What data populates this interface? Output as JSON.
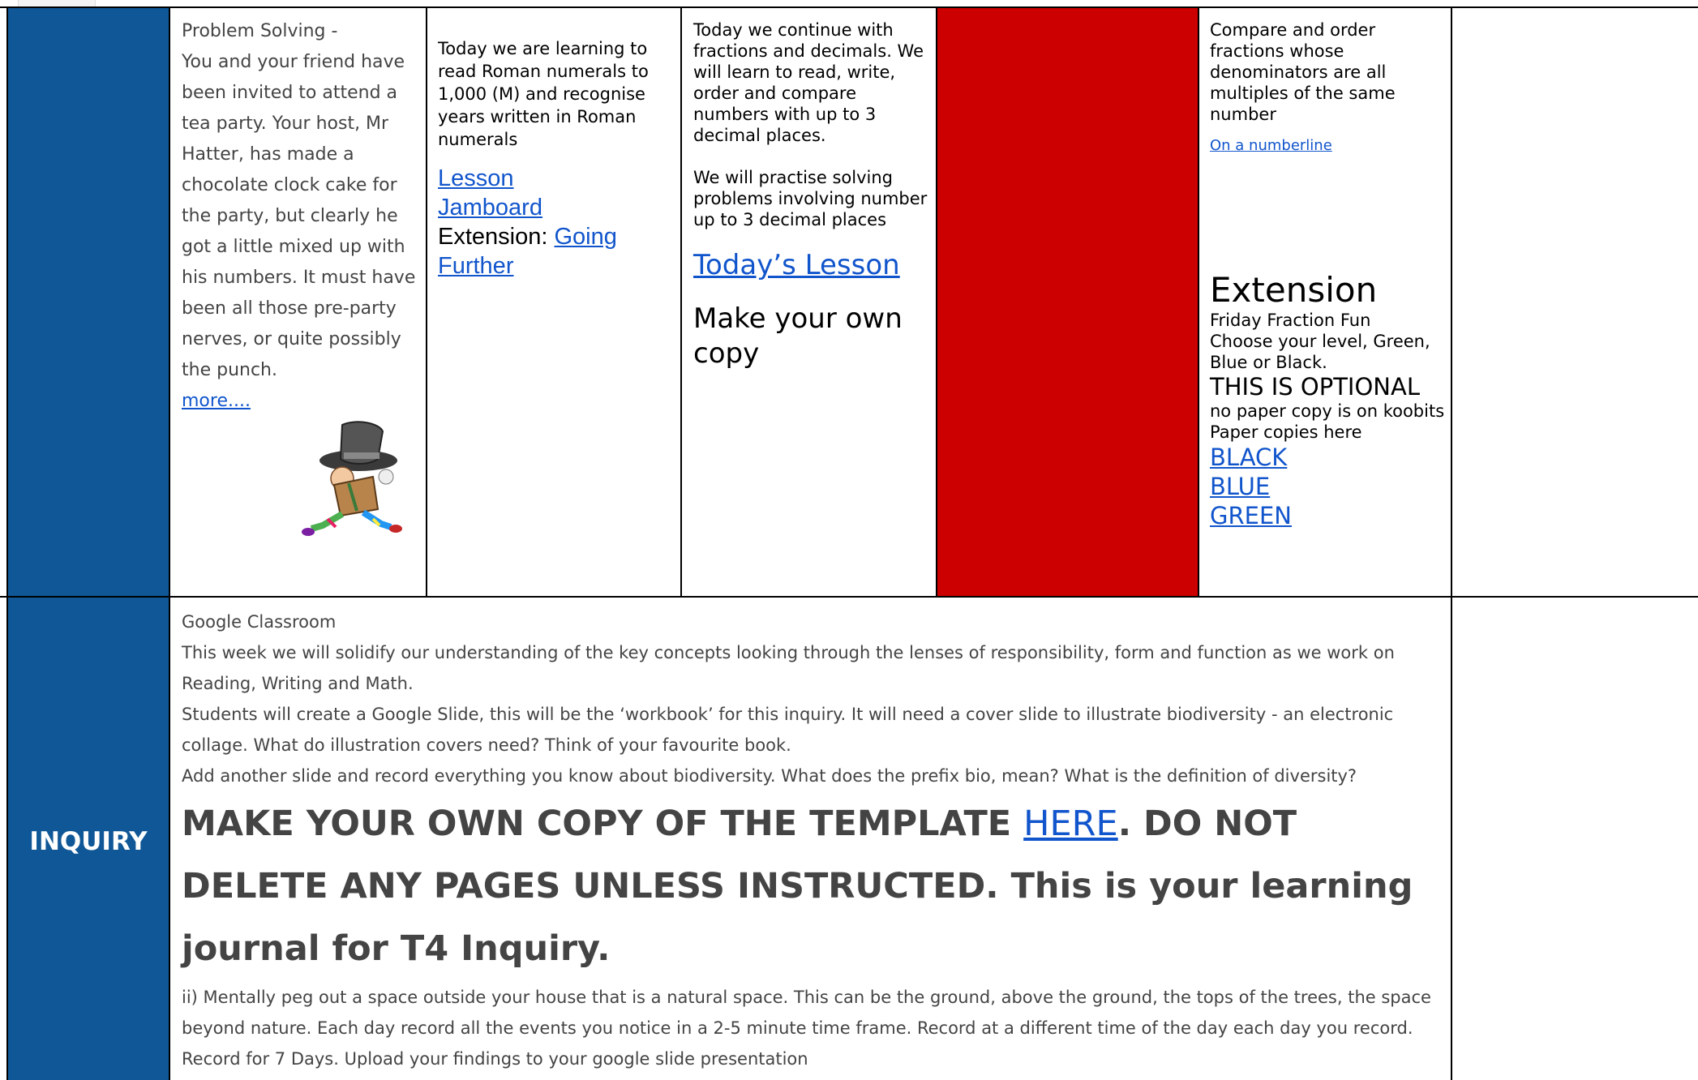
{
  "math_row": {
    "cell1": {
      "title": "Problem Solving -",
      "body": "You and your friend have been invited to attend a tea party. Your host, Mr Hatter, has made a chocolate clock cake for the party, but clearly he got a little mixed up with his numbers. It must have been all those pre-party nerves, or quite possibly the punch.",
      "more_link": "more...."
    },
    "cell2": {
      "intro": "Today we are learning to read Roman numerals to 1,000 (M) and recognise years written in Roman numerals",
      "lesson_link": "Lesson",
      "jamboard_link": "Jamboard",
      "extension_label": "Extension: ",
      "going_further_link": "Going Further"
    },
    "cell3": {
      "intro": "Today we continue with fractions and decimals. We will learn to read, write, order and compare numbers with up to 3 decimal places.",
      "practice": "We will practise solving problems involving number up to 3 decimal places",
      "todays_lesson_link": "Today’s Lesson",
      "make_copy": "Make your own copy"
    },
    "cell4": {
      "color": "#cc0000"
    },
    "cell5": {
      "intro": "Compare and order fractions whose denominators are all multiples of the same number",
      "numberline_link": "On a numberline",
      "extension_heading": "Extension",
      "fun_line1": "Friday Fraction Fun",
      "fun_line2": "Choose your level, Green, Blue or Black.",
      "optional": "THIS IS OPTIONAL",
      "no_paper": "no paper copy is on koobits",
      "paper_here": "Paper copies here",
      "links": [
        "BLACK",
        "BLUE",
        "GREEN"
      ]
    }
  },
  "inquiry_row": {
    "label": "INQUIRY",
    "title": "Google Classroom",
    "para1": "This week we will solidify our understanding of the key concepts looking through the lenses of responsibility, form and function as we work on Reading, Writing and Math.",
    "para2": "Students will create a Google Slide, this will be the ‘workbook’ for this inquiry. It will need a cover slide to illustrate biodiversity - an electronic collage. What do illustration covers need? Think of your favourite book.",
    "para3": "Add another slide and record everything you know about biodiversity. What does the prefix bio, mean? What is the definition of diversity?",
    "big_text_before": "MAKE YOUR OWN COPY OF THE TEMPLATE ",
    "big_link": "HERE",
    "big_text_after": ". DO NOT DELETE ANY PAGES UNLESS INSTRUCTED. This is your learning journal for T4 Inquiry.",
    "para4": "ii) Mentally peg out a space outside your house that is a natural space. This can be the ground, above the ground, the tops of the trees, the space beyond nature.  Each day record all the events you notice in a 2-5 minute time frame. Record at a different time of the day each day you record. Record for 7 Days. Upload your findings to your google slide presentation"
  },
  "colors": {
    "blue_column": "#0f5797",
    "red_cell": "#cc0000",
    "link": "#1155cc"
  }
}
